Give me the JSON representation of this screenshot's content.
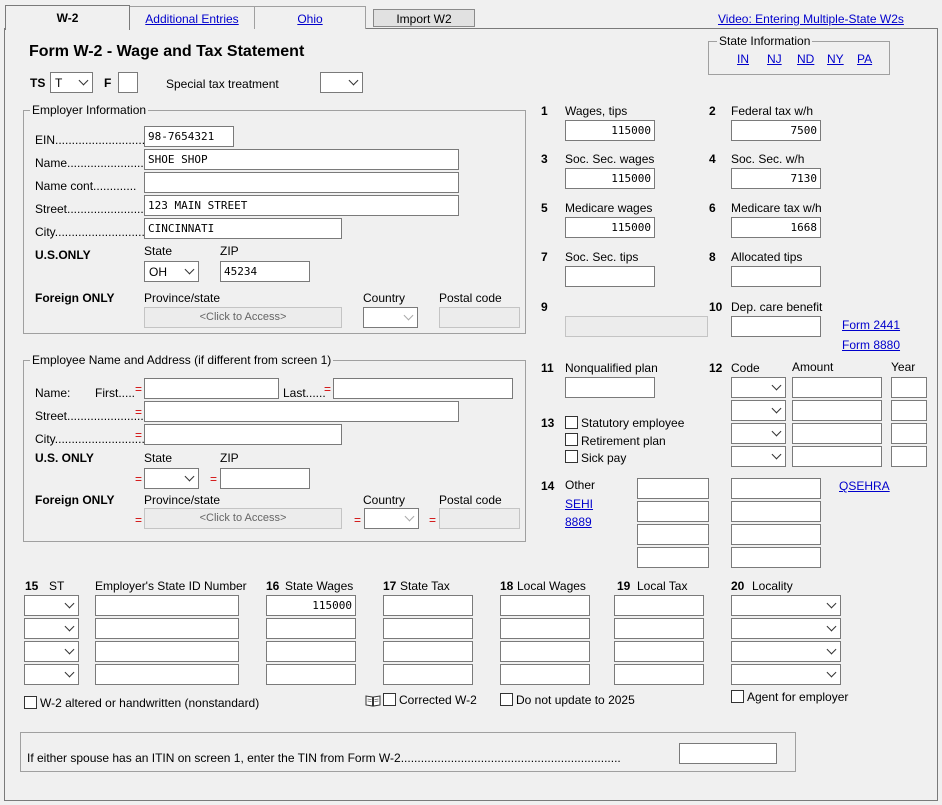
{
  "tabs": {
    "w2": "W-2",
    "additional": "Additional Entries",
    "ohio": "Ohio",
    "import": "Import W2",
    "video": "Video: Entering Multiple-State W2s"
  },
  "title": "Form W-2 - Wage and Tax Statement",
  "top": {
    "ts_label": "TS",
    "ts_value": "T",
    "f_label": "F",
    "special_label": "Special tax treatment"
  },
  "state_info": {
    "title": "State Information",
    "links": [
      "IN",
      "NJ",
      "ND",
      "NY",
      "PA"
    ]
  },
  "employer": {
    "title": "Employer Information",
    "ein_label": "EIN............................",
    "ein": "98-7654321",
    "name_label": "Name.......................",
    "name": "SHOE SHOP",
    "namecont_label": "Name cont.............",
    "street_label": "Street........................",
    "street": "123 MAIN STREET",
    "city_label": "City.............................",
    "city": "CINCINNATI",
    "us_only": "U.S.ONLY",
    "state_label": "State",
    "state": "OH",
    "zip_label": "ZIP",
    "zip": "45234",
    "foreign_only": "Foreign ONLY",
    "province_label": "Province/state",
    "province_btn": "<Click to Access>",
    "country_label": "Country",
    "postal_label": "Postal code"
  },
  "employee": {
    "title": "Employee Name and Address (if different from screen 1)",
    "name_label": "Name:",
    "first_label": "First.....",
    "last_label": "Last......",
    "street_label": "Street........................",
    "city_label": "City.............................",
    "us_only": "U.S. ONLY",
    "state_label": "State",
    "zip_label": "ZIP",
    "foreign_only": "Foreign ONLY",
    "province_label": "Province/state",
    "province_btn": "<Click to Access>",
    "country_label": "Country",
    "postal_label": "Postal code",
    "req": "="
  },
  "boxes": {
    "b1": {
      "num": "1",
      "label": "Wages, tips",
      "value": "115000"
    },
    "b2": {
      "num": "2",
      "label": "Federal tax w/h",
      "value": "7500"
    },
    "b3": {
      "num": "3",
      "label": "Soc. Sec. wages",
      "value": "115000"
    },
    "b4": {
      "num": "4",
      "label": "Soc. Sec. w/h",
      "value": "7130"
    },
    "b5": {
      "num": "5",
      "label": "Medicare wages",
      "value": "115000"
    },
    "b6": {
      "num": "6",
      "label": "Medicare tax w/h",
      "value": "1668"
    },
    "b7": {
      "num": "7",
      "label": "Soc. Sec. tips"
    },
    "b8": {
      "num": "8",
      "label": "Allocated tips"
    },
    "b9": {
      "num": "9"
    },
    "b10": {
      "num": "10",
      "label": "Dep. care benefit",
      "link1": "Form 2441",
      "link2": "Form 8880"
    },
    "b11": {
      "num": "11",
      "label": "Nonqualified  plan"
    },
    "b12": {
      "num": "12",
      "code": "Code",
      "amount": "Amount",
      "year": "Year"
    },
    "b13": {
      "num": "13",
      "statutory": "Statutory employee",
      "retirement": "Retirement plan",
      "sick": "Sick pay"
    },
    "b14": {
      "num": "14",
      "other": "Other",
      "sehi": "SEHI",
      "f8889": "8889",
      "qsehra": "QSEHRA"
    }
  },
  "state_table": {
    "h15": "15",
    "hst": "ST",
    "hid": "Employer's State ID Number",
    "h16": "16",
    "h16l": "State Wages",
    "h17": "17",
    "h17l": "State Tax",
    "h18": "18",
    "h18l": "Local Wages",
    "h19": "19",
    "h19l": "Local Tax",
    "h20": "20",
    "h20l": "Locality",
    "wage1": "115000"
  },
  "bottom": {
    "altered": "W-2 altered or handwritten (nonstandard)",
    "corrected": "Corrected W-2",
    "noupdate": "Do not update to 2025",
    "agent": "Agent for employer",
    "itin": "If either spouse has an ITIN on screen 1, enter the TIN from Form W-2.................................................................."
  }
}
